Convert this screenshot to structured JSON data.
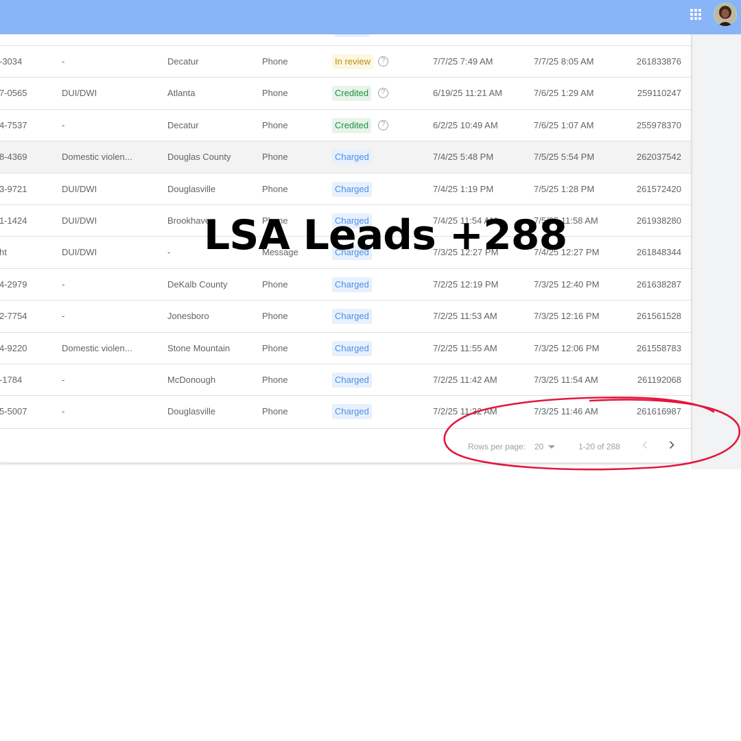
{
  "header": {
    "apps_icon": "apps-grid-icon",
    "avatar_icon": "user-avatar"
  },
  "colors": {
    "header_bg": "#8ab4f8",
    "charged": "#4a90e2",
    "credited": "#1e8e3e",
    "in_review": "#b78b1d",
    "annotation": "#e3173e"
  },
  "table": {
    "rows": [
      {
        "phone": "-3034",
        "lead_type": "-",
        "location": "Decatur",
        "contact": "Phone",
        "status": "In review",
        "status_kind": "review",
        "help": "?",
        "received": "7/7/25 7:49 AM",
        "updated": "7/7/25 8:05 AM",
        "id": "261833876"
      },
      {
        "phone": "7-0565",
        "lead_type": "DUI/DWI",
        "location": "Atlanta",
        "contact": "Phone",
        "status": "Credited",
        "status_kind": "credited",
        "help": "?",
        "received": "6/19/25 11:21 AM",
        "updated": "7/6/25 1:29 AM",
        "id": "259110247"
      },
      {
        "phone": "4-7537",
        "lead_type": "-",
        "location": "Decatur",
        "contact": "Phone",
        "status": "Credited",
        "status_kind": "credited",
        "help": "?",
        "received": "6/2/25 10:49 AM",
        "updated": "7/6/25 1:07 AM",
        "id": "255978370"
      },
      {
        "phone": "8-4369",
        "lead_type": "Domestic violen...",
        "location": "Douglas County",
        "contact": "Phone",
        "status": "Charged",
        "status_kind": "charged",
        "help": "",
        "received": "7/4/25 5:48 PM",
        "updated": "7/5/25 5:54 PM",
        "id": "262037542"
      },
      {
        "phone": "3-9721",
        "lead_type": "DUI/DWI",
        "location": "Douglasville",
        "contact": "Phone",
        "status": "Charged",
        "status_kind": "charged",
        "help": "",
        "received": "7/4/25 1:19 PM",
        "updated": "7/5/25 1:28 PM",
        "id": "261572420"
      },
      {
        "phone": "1-1424",
        "lead_type": "DUI/DWI",
        "location": "Brookhaven",
        "contact": "Phone",
        "status": "Charged",
        "status_kind": "charged",
        "help": "",
        "received": "7/4/25 11:54 AM",
        "updated": "7/5/25 11:58 AM",
        "id": "261938280"
      },
      {
        "phone": "ht",
        "lead_type": "DUI/DWI",
        "location": "-",
        "contact": "Message",
        "status": "Charged",
        "status_kind": "charged",
        "help": "",
        "received": "7/3/25 12:27 PM",
        "updated": "7/4/25 12:27 PM",
        "id": "261848344"
      },
      {
        "phone": "4-2979",
        "lead_type": "-",
        "location": "DeKalb County",
        "contact": "Phone",
        "status": "Charged",
        "status_kind": "charged",
        "help": "",
        "received": "7/2/25 12:19 PM",
        "updated": "7/3/25 12:40 PM",
        "id": "261638287"
      },
      {
        "phone": "2-7754",
        "lead_type": "-",
        "location": "Jonesboro",
        "contact": "Phone",
        "status": "Charged",
        "status_kind": "charged",
        "help": "",
        "received": "7/2/25 11:53 AM",
        "updated": "7/3/25 12:16 PM",
        "id": "261561528"
      },
      {
        "phone": "4-9220",
        "lead_type": "Domestic violen...",
        "location": "Stone Mountain",
        "contact": "Phone",
        "status": "Charged",
        "status_kind": "charged",
        "help": "",
        "received": "7/2/25 11:55 AM",
        "updated": "7/3/25 12:06 PM",
        "id": "261558783"
      },
      {
        "phone": "-1784",
        "lead_type": "-",
        "location": "McDonough",
        "contact": "Phone",
        "status": "Charged",
        "status_kind": "charged",
        "help": "",
        "received": "7/2/25 11:42 AM",
        "updated": "7/3/25 11:54 AM",
        "id": "261192068"
      },
      {
        "phone": "5-5007",
        "lead_type": "-",
        "location": "Douglasville",
        "contact": "Phone",
        "status": "Charged",
        "status_kind": "charged",
        "help": "",
        "received": "7/2/25 11:32 AM",
        "updated": "7/3/25 11:46 AM",
        "id": "261616987"
      }
    ],
    "hover_row": 3
  },
  "pagination": {
    "rows_per_page_label": "Rows per page:",
    "rows_per_page_value": "20",
    "range_text": "1-20 of 288",
    "prev_icon": "chevron-left-icon",
    "next_icon": "chevron-right-icon"
  },
  "overlay": {
    "title": "LSA Leads +288"
  }
}
